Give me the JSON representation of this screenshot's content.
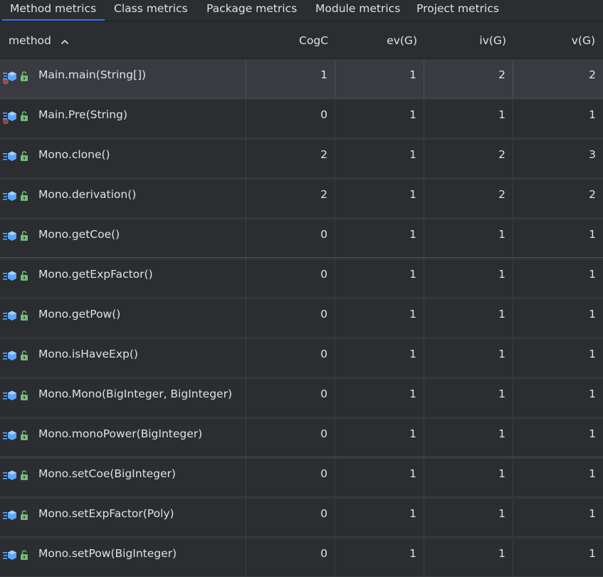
{
  "tabs": [
    {
      "label": "Method metrics",
      "active": true
    },
    {
      "label": "Class metrics",
      "active": false
    },
    {
      "label": "Package metrics",
      "active": false
    },
    {
      "label": "Module metrics",
      "active": false
    },
    {
      "label": "Project metrics",
      "active": false
    }
  ],
  "table": {
    "columns": [
      "method",
      "CogC",
      "ev(G)",
      "iv(G)",
      "v(G)"
    ],
    "sort": {
      "column": "method",
      "direction": "ascending"
    },
    "rows": [
      {
        "method": "Main.main(String[])",
        "CogC": "1",
        "evG": "1",
        "ivG": "2",
        "vG": "2",
        "icon": "method-icon",
        "error_marker": true,
        "selected": true
      },
      {
        "method": "Main.Pre(String)",
        "CogC": "0",
        "evG": "1",
        "ivG": "1",
        "vG": "1",
        "icon": "method-icon",
        "error_marker": true,
        "selected": false
      },
      {
        "method": "Mono.clone()",
        "CogC": "2",
        "evG": "1",
        "ivG": "2",
        "vG": "3",
        "icon": "method-icon",
        "error_marker": false,
        "selected": false
      },
      {
        "method": "Mono.derivation()",
        "CogC": "2",
        "evG": "1",
        "ivG": "2",
        "vG": "2",
        "icon": "method-icon",
        "error_marker": false,
        "selected": false
      },
      {
        "method": "Mono.getCoe()",
        "CogC": "0",
        "evG": "1",
        "ivG": "1",
        "vG": "1",
        "icon": "method-icon",
        "error_marker": false,
        "selected": false
      },
      {
        "method": "Mono.getExpFactor()",
        "CogC": "0",
        "evG": "1",
        "ivG": "1",
        "vG": "1",
        "icon": "method-icon",
        "error_marker": false,
        "selected": false
      },
      {
        "method": "Mono.getPow()",
        "CogC": "0",
        "evG": "1",
        "ivG": "1",
        "vG": "1",
        "icon": "method-icon",
        "error_marker": false,
        "selected": false
      },
      {
        "method": "Mono.isHaveExp()",
        "CogC": "0",
        "evG": "1",
        "ivG": "1",
        "vG": "1",
        "icon": "method-icon",
        "error_marker": false,
        "selected": false
      },
      {
        "method": "Mono.Mono(BigInteger, BigInteger)",
        "CogC": "0",
        "evG": "1",
        "ivG": "1",
        "vG": "1",
        "icon": "method-icon",
        "error_marker": false,
        "selected": false
      },
      {
        "method": "Mono.monoPower(BigInteger)",
        "CogC": "0",
        "evG": "1",
        "ivG": "1",
        "vG": "1",
        "icon": "method-icon",
        "error_marker": false,
        "selected": false
      },
      {
        "method": "Mono.setCoe(BigInteger)",
        "CogC": "0",
        "evG": "1",
        "ivG": "1",
        "vG": "1",
        "icon": "method-icon",
        "error_marker": false,
        "selected": false
      },
      {
        "method": "Mono.setExpFactor(Poly)",
        "CogC": "0",
        "evG": "1",
        "ivG": "1",
        "vG": "1",
        "icon": "method-icon",
        "error_marker": false,
        "selected": false
      },
      {
        "method": "Mono.setPow(BigInteger)",
        "CogC": "0",
        "evG": "1",
        "ivG": "1",
        "vG": "1",
        "icon": "method-icon",
        "error_marker": false,
        "selected": false
      }
    ]
  },
  "colors": {
    "background": "#2b2d30",
    "selected_row": "#393b40",
    "accent": "#3574f0",
    "method_icon": "#5aa9ff",
    "lock_icon": "#73bd79",
    "error_marker": "#e55b5b",
    "text": "#dfe1e5"
  }
}
